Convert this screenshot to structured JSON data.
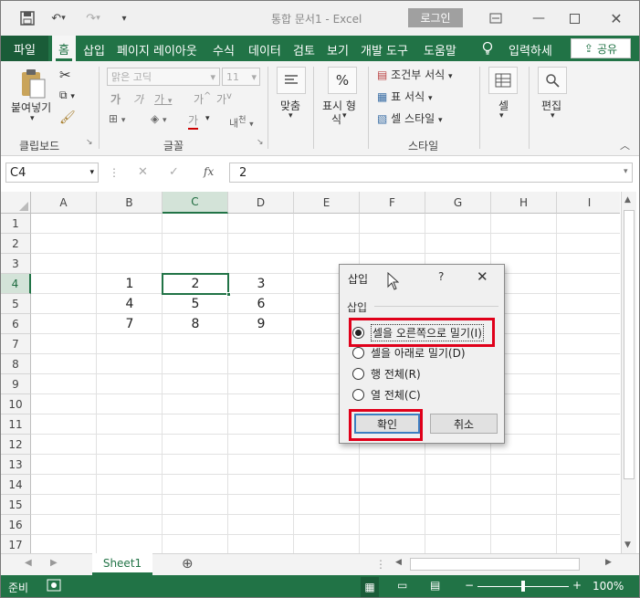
{
  "titlebar": {
    "title": "통합 문서1  -  Excel",
    "login_label": "로그인"
  },
  "menu": {
    "tabs": [
      "파일",
      "홈",
      "삽입",
      "페이지 레이아웃",
      "수식",
      "데이터",
      "검토",
      "보기",
      "개발 도구",
      "도움말"
    ],
    "tell_me": "입력하세",
    "share_label": "공유"
  },
  "ribbon": {
    "paste_label": "붙여넣기",
    "clipboard_label": "클립보드",
    "font_name": "맑은 고딕",
    "font_size": "11",
    "font_label": "글꼴",
    "align_label": "맞춤",
    "number_label": "표시 형식",
    "number_label_2": "식",
    "number_label_1": "표시 형",
    "conditional_label": "조건부 서식",
    "table_format_label": "표 서식",
    "cell_style_label": "셀 스타일",
    "style_label": "스타일",
    "cells_label": "셀",
    "edit_label": "편집"
  },
  "formula_bar": {
    "name_box": "C4",
    "formula": "2"
  },
  "grid": {
    "columns": [
      "A",
      "B",
      "C",
      "D",
      "E",
      "F",
      "G",
      "H",
      "I"
    ],
    "rows": [
      "1",
      "2",
      "3",
      "4",
      "5",
      "6",
      "7",
      "8",
      "9",
      "10",
      "11",
      "12",
      "13",
      "14",
      "15",
      "16",
      "17"
    ],
    "values": {
      "B4": "1",
      "C4": "2",
      "D4": "3",
      "B5": "4",
      "C5": "5",
      "D5": "6",
      "B6": "7",
      "C6": "8",
      "D6": "9"
    }
  },
  "dialog": {
    "title": "삽입",
    "help": "?",
    "group_label": "삽입",
    "options": [
      "셀을 오른쪽으로 밀기(I)",
      "셀을 아래로 밀기(D)",
      "행 전체(R)",
      "열 전체(C)"
    ],
    "ok_label": "확인",
    "cancel_label": "취소"
  },
  "sheets": [
    "Sheet1"
  ],
  "status": {
    "ready": "준비",
    "zoom": "100%"
  },
  "colors": {
    "excel_green": "#217346",
    "highlight_red": "#e0001a"
  }
}
